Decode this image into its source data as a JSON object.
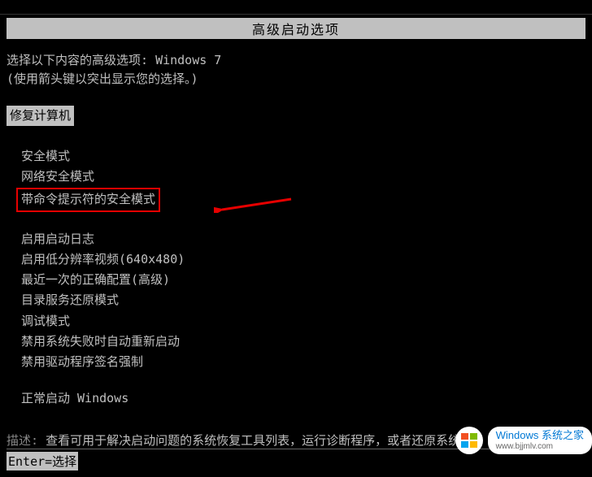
{
  "title": "高级启动选项",
  "prompt_line1": "选择以下内容的高级选项: Windows 7",
  "prompt_line2": "(使用箭头键以突出显示您的选择。)",
  "repair_label": "修复计算机",
  "group1": {
    "safe_mode": "安全模式",
    "safe_mode_net": "网络安全模式",
    "safe_mode_cmd": "带命令提示符的安全模式"
  },
  "group2": {
    "boot_log": "启用启动日志",
    "low_res": "启用低分辨率视频(640x480)",
    "last_known": "最近一次的正确配置(高级)",
    "ds_restore": "目录服务还原模式",
    "debug": "调试模式",
    "disable_auto_restart": "禁用系统失败时自动重新启动",
    "disable_driver_sig": "禁用驱动程序签名强制"
  },
  "group3": {
    "normal": "正常启动 Windows"
  },
  "desc_label": "描述: ",
  "desc_text": "查看可用于解决启动问题的系统恢复工具列表，运行诊断程序，或者还原系统。",
  "footer": "Enter=选择",
  "watermark": {
    "brand": "Windows 系统之家",
    "url": "www.bjjmlv.com"
  }
}
